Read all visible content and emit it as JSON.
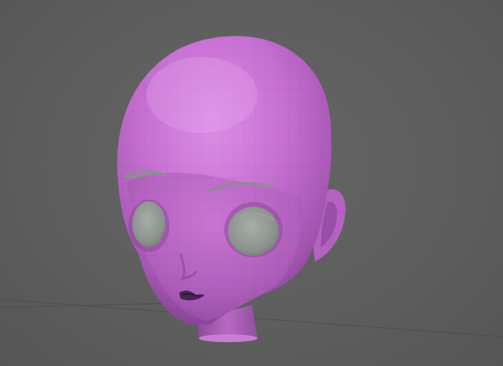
{
  "viewport": {
    "background_color": "#5f5f5f",
    "grid_line_color": "#4d4d4d"
  },
  "model": {
    "kind": "stylized head mesh",
    "skin_color": "#c56fd0",
    "skin_highlight_color": "#d98ae3",
    "skin_shadow_color": "#7f3d8a",
    "eye_color": "#8f9591",
    "brow_color": "#8b8f8c",
    "mouth_color": "#4a2456"
  }
}
